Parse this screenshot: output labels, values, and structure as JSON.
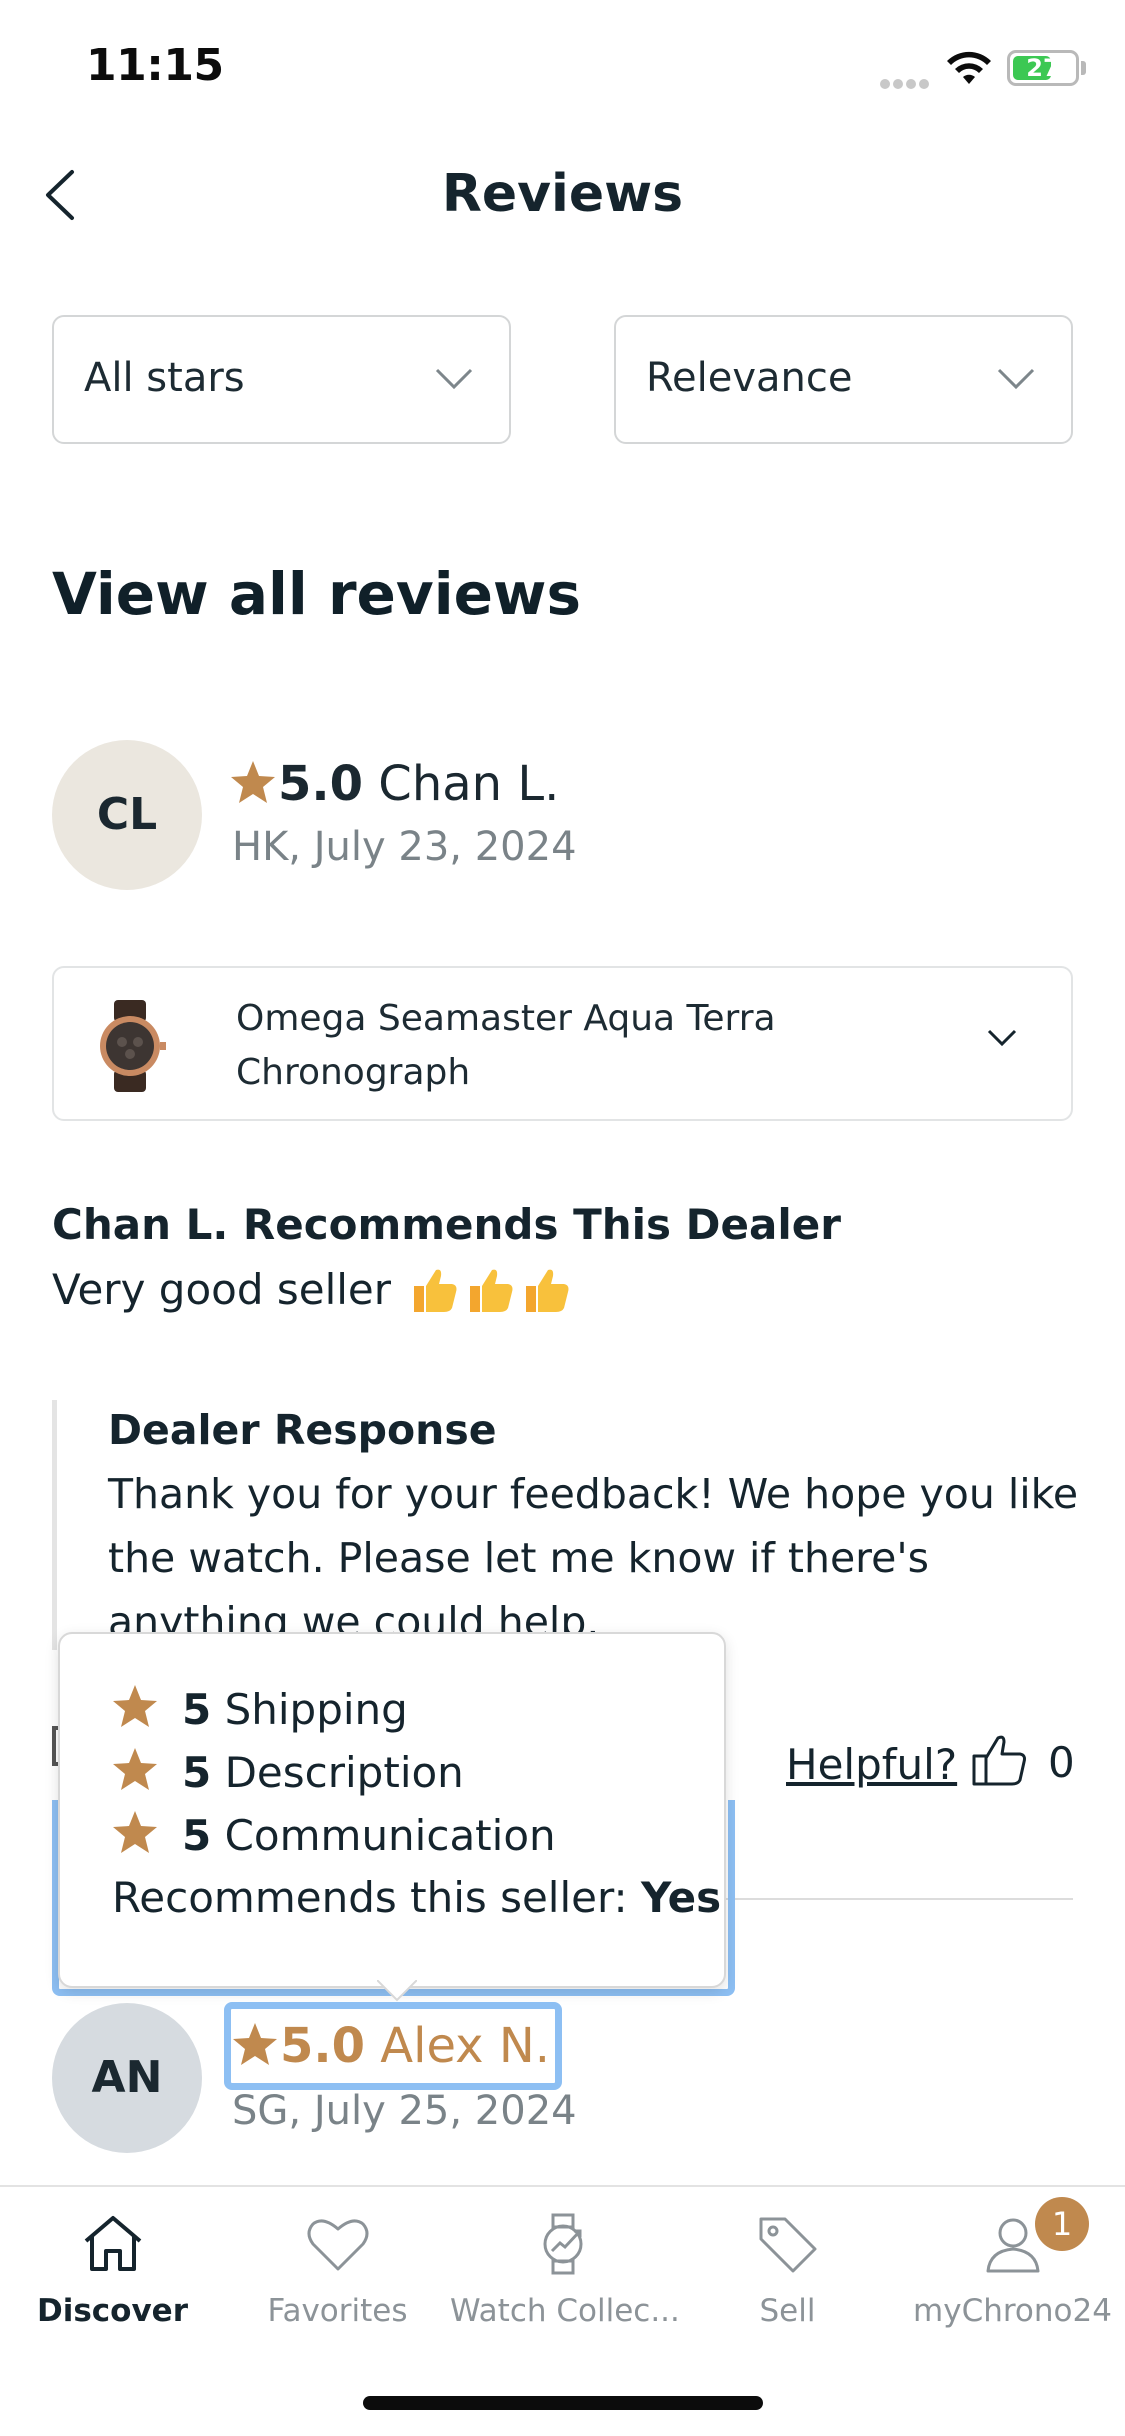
{
  "status_bar": {
    "time": "11:15",
    "battery": "27"
  },
  "header": {
    "title": "Reviews"
  },
  "filters": {
    "stars": "All stars",
    "sort": "Relevance"
  },
  "section_title": "View all reviews",
  "review1": {
    "initials": "CL",
    "rating": "5.0",
    "name": "Chan L.",
    "meta": "HK, July 23, 2024",
    "product": "Omega Seamaster Aqua Terra Chronograph",
    "recommend_title": "Chan L. Recommends This Dealer",
    "body": "Very good seller",
    "dealer_response_title": "Dealer Response",
    "dealer_response": "Thank you for your feedback! We hope you like the watch. Please let me know if there's anything we could help.",
    "helpful": "Helpful?",
    "helpful_count": "0"
  },
  "tooltip": {
    "rows": [
      {
        "score": "5",
        "label": "Shipping"
      },
      {
        "score": "5",
        "label": "Description"
      },
      {
        "score": "5",
        "label": "Communication"
      }
    ],
    "recommends_label": "Recommends this seller:",
    "recommends_value": "Yes"
  },
  "review2": {
    "initials": "AN",
    "rating": "5.0",
    "name": "Alex N.",
    "meta": "SG, July 25, 2024"
  },
  "tabbar": {
    "items": [
      {
        "label": "Discover",
        "icon": "home-icon"
      },
      {
        "label": "Favorites",
        "icon": "heart-icon"
      },
      {
        "label": "Watch Collec...",
        "icon": "watch-icon"
      },
      {
        "label": "Sell",
        "icon": "tag-icon"
      },
      {
        "label": "myChrono24",
        "icon": "user-icon"
      }
    ],
    "badge": "1"
  },
  "colors": {
    "accent": "#c0894e",
    "focus": "#8dbff3",
    "text": "#15242d"
  }
}
